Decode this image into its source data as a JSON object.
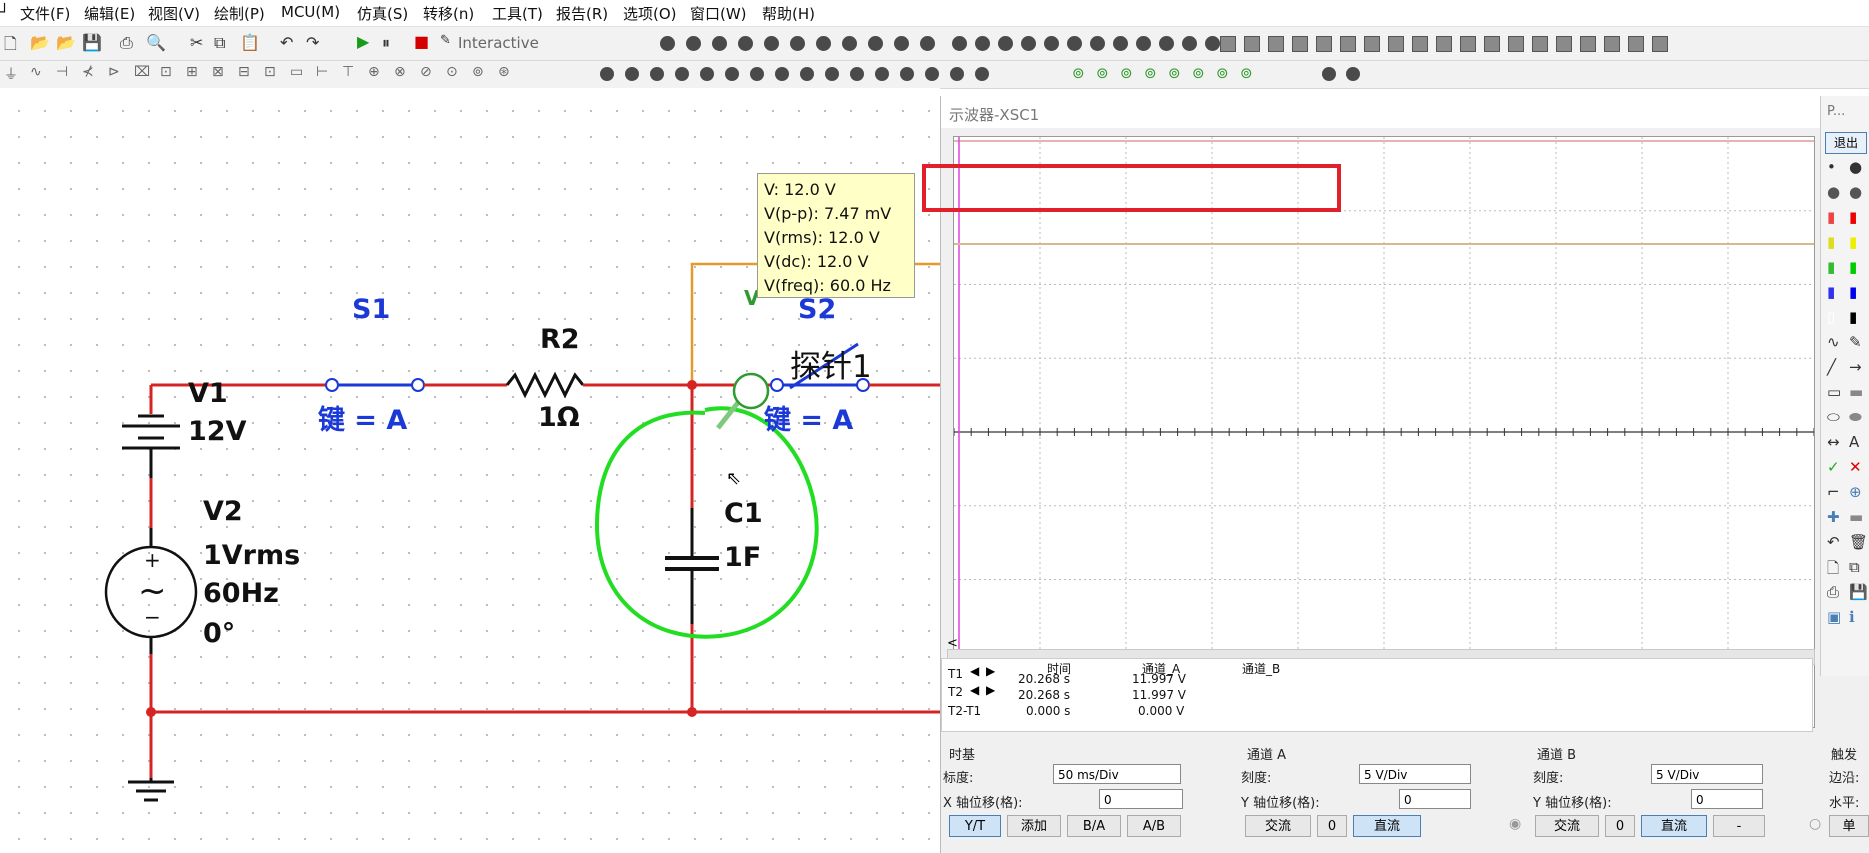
{
  "menu": [
    "文件(F)",
    "编辑(E)",
    "视图(V)",
    "绘制(P)",
    "MCU(M)",
    "仿真(S)",
    "转移(n)",
    "工具(T)",
    "报告(R)",
    "选项(O)",
    "窗口(W)",
    "帮助(H)"
  ],
  "toolbar": {
    "mode_label": "Interactive"
  },
  "circuit": {
    "s1_name": "S1",
    "s1_key": "键 = A",
    "r2_name": "R2",
    "r2_value": "1Ω",
    "s2_name": "S2",
    "s2_key": "键 = A",
    "probe_label": "探针1",
    "probe_badge": "V",
    "v1_name": "V1",
    "v1_value": "12V",
    "v2_name": "V2",
    "v2_value": "1Vrms",
    "v2_freq": "60Hz",
    "v2_phase": "0°",
    "c1_name": "C1",
    "c1_value": "1F",
    "plus": "+",
    "minus": "−",
    "tilde": "~"
  },
  "tooltip": {
    "v": "V: 12.0 V",
    "vpp": "V(p-p): 7.47 mV",
    "vrms": "V(rms): 12.0 V",
    "vdc": "V(dc): 12.0 V",
    "vfreq": "V(freq): 60.0 Hz"
  },
  "scope": {
    "title": "示波器-XSC1",
    "side_tab": "P...",
    "exit_button": "退出",
    "scroll_left": "<",
    "cursor_table": {
      "headers": [
        "时间",
        "通道_A",
        "通道_B"
      ],
      "rows": [
        {
          "label": "T1",
          "time": "20.268 s",
          "a": "11.997 V",
          "b": ""
        },
        {
          "label": "T2",
          "time": "20.268 s",
          "a": "11.997 V",
          "b": ""
        },
        {
          "label": "T2-T1",
          "time": "0.000 s",
          "a": "0.000 V",
          "b": ""
        }
      ]
    },
    "timebase": {
      "title": "时基",
      "scale_label": "标度:",
      "scale_value": "50 ms/Div",
      "xpos_label": "X 轴位移(格):",
      "xpos_value": "0",
      "buttons": [
        "Y/T",
        "添加",
        "B/A",
        "A/B"
      ]
    },
    "channel_a": {
      "title": "通道 A",
      "scale_label": "刻度:",
      "scale_value": "5  V/Div",
      "ypos_label": "Y 轴位移(格):",
      "ypos_value": "0",
      "buttons": [
        "交流",
        "0",
        "直流"
      ]
    },
    "channel_b": {
      "title": "通道 B",
      "scale_label": "刻度:",
      "scale_value": "5  V/Div",
      "ypos_label": "Y 轴位移(格):",
      "ypos_value": "0",
      "buttons": [
        "交流",
        "0",
        "直流",
        "-"
      ]
    },
    "trigger": {
      "title": "触发",
      "edge_label": "边沿:",
      "level_label": "水平:",
      "single_button": "单"
    }
  },
  "colors": {
    "wire": "#d62424",
    "label_blue": "#1a39d6",
    "trace": "#d9b98a",
    "highlight": "#e0202a",
    "circle": "#22dd22"
  }
}
